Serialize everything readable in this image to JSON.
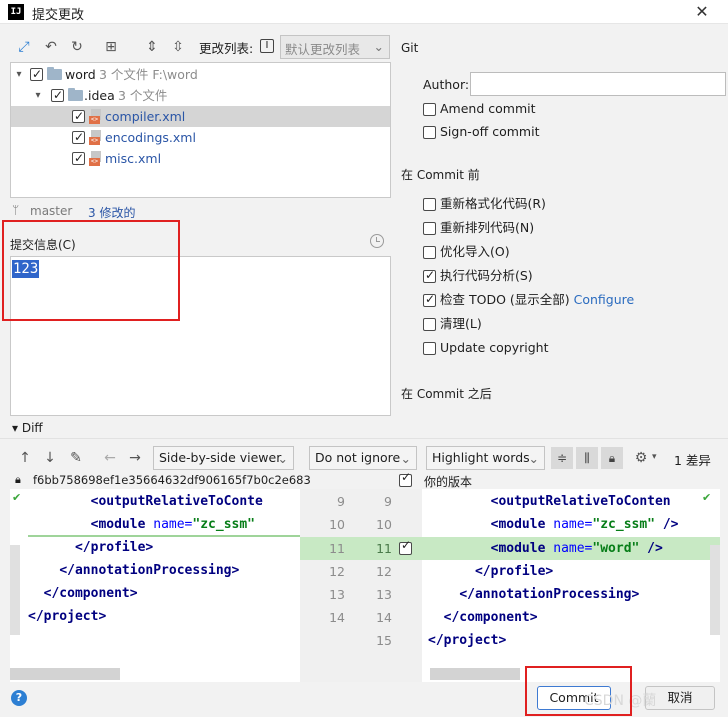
{
  "window": {
    "title": "提交更改",
    "icon": "intellij-icon",
    "icon_text": "IJ",
    "close_glyph": "✕"
  },
  "toolbar": {
    "changes_label": "更改列表:",
    "group_key": "I",
    "changelist_value": "默认更改列表"
  },
  "tree": {
    "root": {
      "name": "word",
      "meta": "3 个文件  F:\\word"
    },
    "folder": {
      "name": ".idea",
      "meta": "3 个文件"
    },
    "files": [
      {
        "name": "compiler.xml"
      },
      {
        "name": "encodings.xml"
      },
      {
        "name": "misc.xml"
      }
    ]
  },
  "branch": {
    "name": "master",
    "modified": "3 修改的"
  },
  "message": {
    "label": "提交信息(C)",
    "text": "123"
  },
  "git": {
    "section_label": "Git",
    "author_label": "Author:",
    "author_value": "",
    "amend": "Amend commit",
    "signoff": "Sign-off commit"
  },
  "before_commit": {
    "label": "在 Commit 前",
    "options": [
      {
        "label": "重新格式化代码(R)",
        "checked": false
      },
      {
        "label": "重新排列代码(N)",
        "checked": false
      },
      {
        "label": "优化导入(O)",
        "checked": false
      },
      {
        "label": "执行代码分析(S)",
        "checked": true
      },
      {
        "label": "检查 TODO (显示全部)",
        "checked": true,
        "link": "Configure"
      },
      {
        "label": "清理(L)",
        "checked": false
      },
      {
        "label": "Update copyright",
        "checked": false
      }
    ]
  },
  "after_commit": {
    "label": "在 Commit 之后"
  },
  "diff": {
    "label": "Diff",
    "viewer": "Side-by-side viewer",
    "ignore": "Do not ignore",
    "highlight": "Highlight words",
    "diff_count": "1 差异",
    "left_hash": "f6bb758698ef1e35664632df906165f7b0c2e683",
    "right_title": "你的版本",
    "left_lines": [
      {
        "indent": "        ",
        "tag": "<outputRelativeToConte",
        "attr": "",
        "val": "",
        "end": ""
      },
      {
        "indent": "        ",
        "tag": "<module ",
        "attr": "name=",
        "val": "\"zc_ssm\"",
        "end": ""
      },
      {
        "indent": "      ",
        "tag": "</profile>",
        "attr": "",
        "val": "",
        "end": ""
      },
      {
        "indent": "    ",
        "tag": "</annotationProcessing>",
        "attr": "",
        "val": "",
        "end": ""
      },
      {
        "indent": "  ",
        "tag": "</component>",
        "attr": "",
        "val": "",
        "end": ""
      },
      {
        "indent": "",
        "tag": "</project>",
        "attr": "",
        "val": "",
        "end": ""
      }
    ],
    "right_lines": [
      {
        "indent": "        ",
        "tag": "<outputRelativeToConten",
        "attr": "",
        "val": "",
        "end": ""
      },
      {
        "indent": "        ",
        "tag": "<module ",
        "attr": "name=",
        "val": "\"zc_ssm\"",
        "end": " />"
      },
      {
        "indent": "        ",
        "tag": "<module ",
        "attr": "name=",
        "val": "\"word\"",
        "end": " />"
      },
      {
        "indent": "      ",
        "tag": "</profile>",
        "attr": "",
        "val": "",
        "end": ""
      },
      {
        "indent": "    ",
        "tag": "</annotationProcessing>",
        "attr": "",
        "val": "",
        "end": ""
      },
      {
        "indent": "  ",
        "tag": "</component>",
        "attr": "",
        "val": "",
        "end": ""
      },
      {
        "indent": "",
        "tag": "</project>",
        "attr": "",
        "val": "",
        "end": ""
      }
    ],
    "left_numbers": [
      "9",
      "10",
      "11",
      "12",
      "13",
      "14"
    ],
    "right_numbers": [
      "9",
      "10",
      "11",
      "12",
      "13",
      "14",
      "15"
    ]
  },
  "buttons": {
    "commit": "Commit",
    "cancel": "取消",
    "help": "?"
  },
  "watermark": "CSDN @蘭",
  "colors": {
    "accent": "#2f65ca",
    "added_line": "#c8e9c4",
    "highlight_box": "#e02020",
    "link": "#2a55a6"
  }
}
